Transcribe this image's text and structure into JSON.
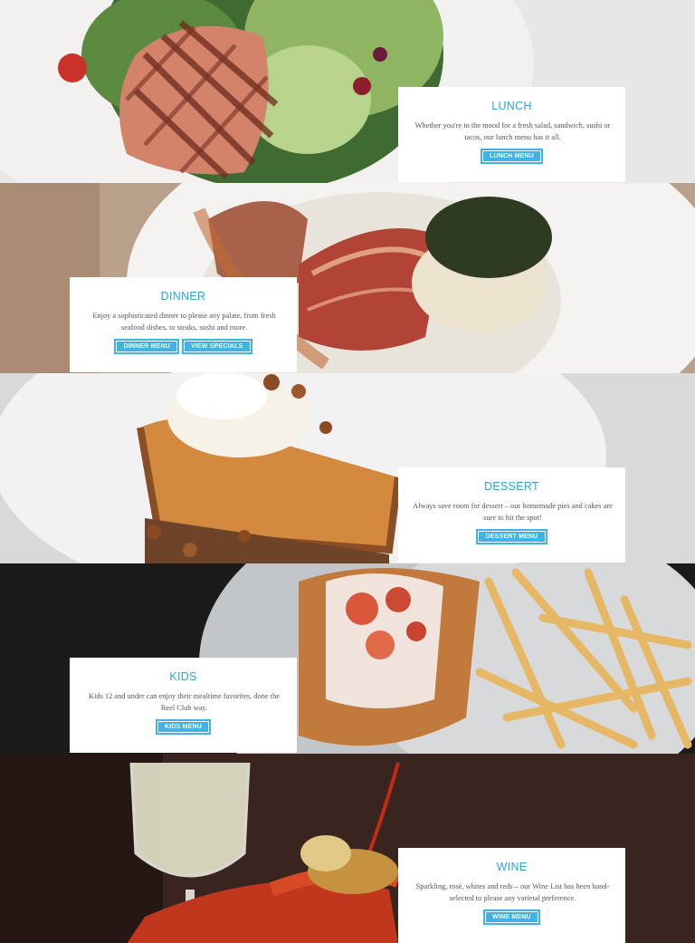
{
  "sections": [
    {
      "key": "lunch",
      "title": "LUNCH",
      "text": "Whether you're in the mood for a fresh salad, sandwich, sushi or tacos, our lunch menu has it all.",
      "buttons": [
        "LUNCH MENU"
      ]
    },
    {
      "key": "dinner",
      "title": "DINNER",
      "text": "Enjoy a sophisticated dinner to please any palate, from fresh seafood dishes, to steaks, sushi and more.",
      "buttons": [
        "DINNER MENU",
        "VIEW SPECIALS"
      ]
    },
    {
      "key": "dessert",
      "title": "DESSERT",
      "text": "Always save room for dessert – our homemade pies and cakes are sure to hit the spot!",
      "buttons": [
        "DESSERT MENU"
      ]
    },
    {
      "key": "kids",
      "title": "KIDS",
      "text": "Kids 12 and under can enjoy their mealtime favorites, done the Reel Club way.",
      "buttons": [
        "KIDS MENU"
      ]
    },
    {
      "key": "wine",
      "title": "WINE",
      "text": "Sparkling, rosé, whites and reds – our Wine List has been hand-selected to please any varietal preference.",
      "buttons": [
        "WINE MENU"
      ]
    }
  ],
  "colors": {
    "accent": "#2aa6d9",
    "button": "#3fb2e6"
  }
}
